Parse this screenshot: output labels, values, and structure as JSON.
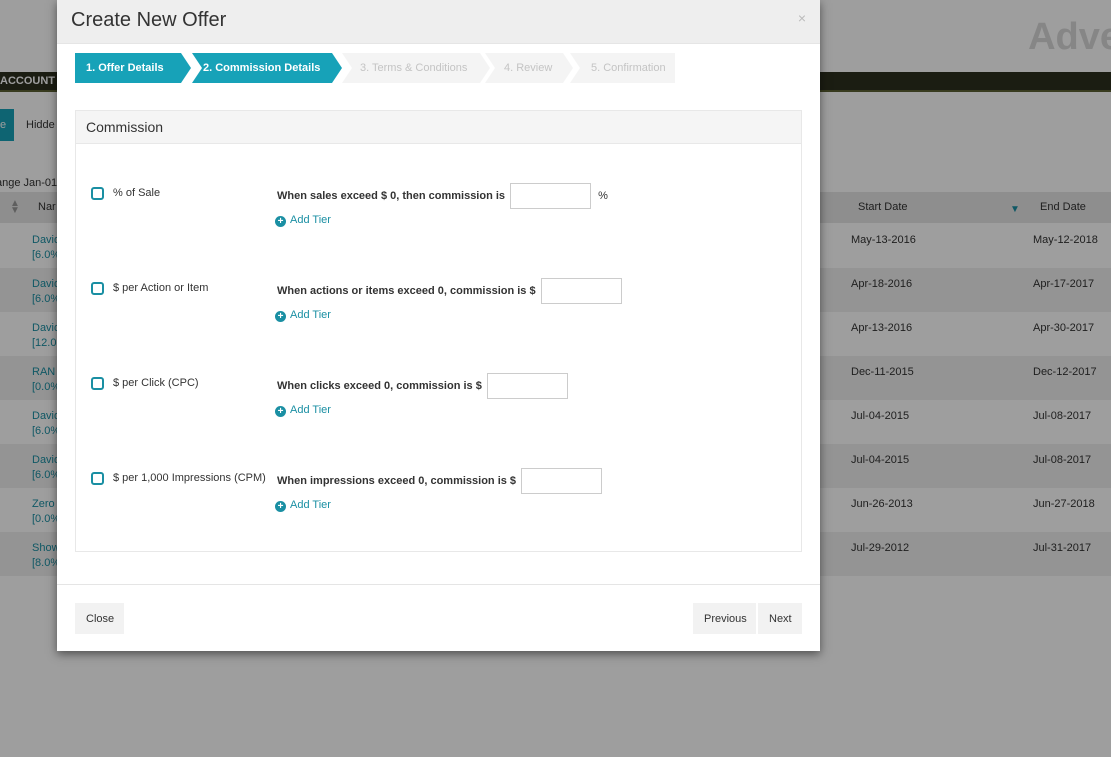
{
  "background": {
    "brand": "Adve",
    "topbar_label": "ACCOUNT",
    "tab_active": "e",
    "tab_hidden": "Hidde",
    "range_text": "ange Jan-01",
    "columns": {
      "name": "Nar",
      "start_date": "Start Date",
      "end_date": "End Date"
    },
    "rows": [
      {
        "name": "David",
        "rate": "[6.0%",
        "start": "May-13-2016",
        "end": "May-12-2018"
      },
      {
        "name": "David",
        "rate": "[6.0%",
        "start": "Apr-18-2016",
        "end": "Apr-17-2017"
      },
      {
        "name": "David",
        "rate": "[12.0",
        "start": "Apr-13-2016",
        "end": "Apr-30-2017"
      },
      {
        "name": "RAN",
        "rate": "[0.0%",
        "start": "Dec-11-2015",
        "end": "Dec-12-2017"
      },
      {
        "name": "David",
        "rate": "[6.0%",
        "start": "Jul-04-2015",
        "end": "Jul-08-2017"
      },
      {
        "name": "David",
        "rate": "[6.0%",
        "start": "Jul-04-2015",
        "end": "Jul-08-2017"
      },
      {
        "name": "Zero",
        "rate": "[0.0%",
        "start": "Jun-26-2013",
        "end": "Jun-27-2018"
      },
      {
        "name": "Show",
        "rate": "[8.0%",
        "start": "Jul-29-2012",
        "end": "Jul-31-2017"
      }
    ]
  },
  "modal": {
    "title": "Create New Offer",
    "close_glyph": "×",
    "steps": [
      {
        "label": "1. Offer Details",
        "state": "done"
      },
      {
        "label": "2. Commission Details",
        "state": "done"
      },
      {
        "label": "3. Terms & Conditions",
        "state": "todo"
      },
      {
        "label": "4. Review",
        "state": "todo"
      },
      {
        "label": "5. Confirmation",
        "state": "todo"
      }
    ],
    "panel_title": "Commission",
    "commission_types": [
      {
        "label": "% of Sale",
        "rule": "When sales exceed $ 0, then commission is",
        "suffix": "%",
        "value": "",
        "add_tier": "Add Tier"
      },
      {
        "label": "$ per Action or Item",
        "rule": "When actions or items exceed 0, commission is $",
        "suffix": "",
        "value": "",
        "add_tier": "Add Tier"
      },
      {
        "label": "$ per Click (CPC)",
        "rule": "When clicks exceed 0, commission is $",
        "suffix": "",
        "value": "",
        "add_tier": "Add Tier"
      },
      {
        "label": "$ per 1,000 Impressions (CPM)",
        "rule": "When impressions exceed 0, commission is $",
        "suffix": "",
        "value": "",
        "add_tier": "Add Tier"
      }
    ],
    "buttons": {
      "close": "Close",
      "previous": "Previous",
      "next": "Next"
    }
  },
  "colors": {
    "accent": "#17a2b8",
    "link": "#1a8fa3"
  }
}
